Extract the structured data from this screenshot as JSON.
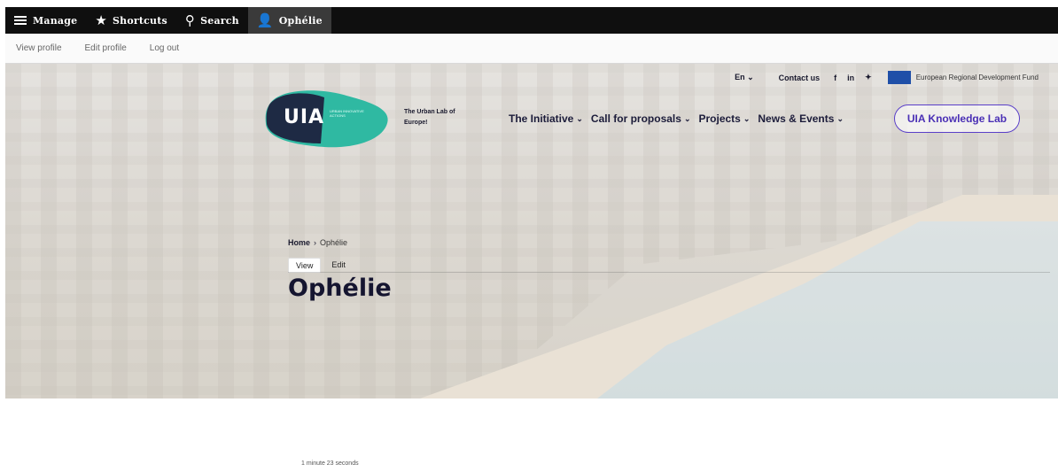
{
  "admin_toolbar": {
    "manage": "Manage",
    "shortcuts": "Shortcuts",
    "search": "Search",
    "user": "Ophélie"
  },
  "tray": {
    "links": [
      "View profile",
      "Edit profile",
      "Log out"
    ]
  },
  "utility": {
    "language": "En",
    "contact": "Contact us",
    "social": [
      "f",
      "in",
      "♥"
    ],
    "fund_label": "European Regional Development Fund"
  },
  "logo": {
    "text": "UIA",
    "small_text": "URBAN INNOVATIVE ACTIONS",
    "tagline": "The Urban Lab of Europe!"
  },
  "nav": {
    "items": [
      "The Initiative",
      "Call for proposals",
      "Projects",
      "News & Events"
    ],
    "cta": "UIA Knowledge Lab"
  },
  "breadcrumb": {
    "home": "Home",
    "current": "Ophélie"
  },
  "tabs": [
    "View",
    "Edit"
  ],
  "page_title": "Ophélie",
  "reading_time": "1 minute 23 seconds",
  "colors": {
    "toolbar": "#0f0f0f",
    "logo_teal": "#2fb9a2",
    "logo_dark": "#1e2a44",
    "cta": "#5a3fc9"
  }
}
